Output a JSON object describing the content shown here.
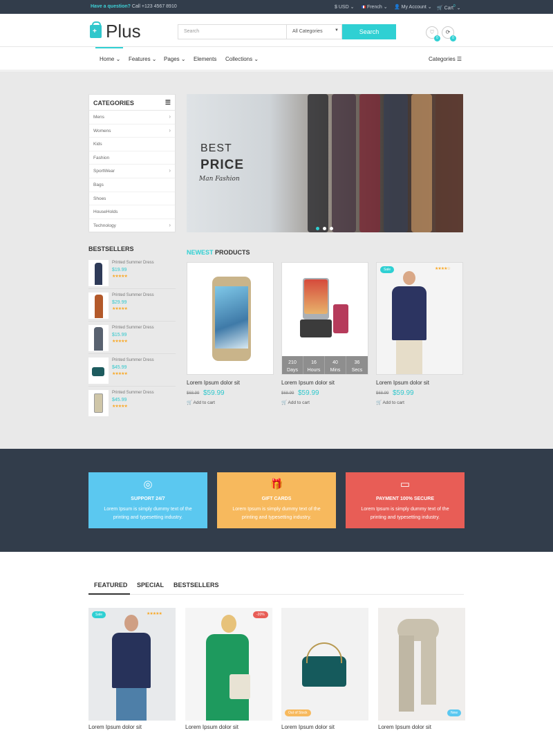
{
  "topbar": {
    "question": "Have a question?",
    "phone": "Call +123 4567 8910",
    "currency": "USD",
    "language": "French",
    "account": "My Account",
    "cart": "Cart",
    "cart_count": "0"
  },
  "header": {
    "logo": "Plus",
    "search_placeholder": "Search",
    "category_select": "All Categories",
    "search_button": "Search",
    "wishlist_count": "0",
    "compare_count": "0"
  },
  "nav": {
    "items": [
      "Home",
      "Features",
      "Pages",
      "Elements",
      "Collections"
    ],
    "right": "Categories"
  },
  "sidebar": {
    "title": "CATEGORIES",
    "items": [
      "Mens",
      "Womens",
      "Kids",
      "Fashion",
      "SportWear",
      "Bags",
      "Shoes",
      "HouseHolds",
      "Technology"
    ]
  },
  "banner": {
    "line1": "BEST",
    "line2": "PRICE",
    "line3": "Man Fashion"
  },
  "bestsellers": {
    "title": "BESTSELLERS",
    "items": [
      {
        "name": "Printed Summer Dress",
        "price": "$19.99",
        "stars": "★★★★★"
      },
      {
        "name": "Printed Summer Dress",
        "price": "$29.99",
        "stars": "★★★★★"
      },
      {
        "name": "Printed Summer Dress",
        "price": "$15.99",
        "stars": "★★★★★"
      },
      {
        "name": "Printed Summer Dress",
        "price": "$45.99",
        "stars": "★★★★★"
      },
      {
        "name": "Printed Summer Dress",
        "price": "$45.99",
        "stars": "★★★★★"
      }
    ]
  },
  "newest": {
    "title_accent": "NEWEST",
    "title_rest": "PRODUCTS",
    "products": [
      {
        "name": "Lorem Ipsum dolor sit",
        "old": "$68.99",
        "price": "$59.99",
        "add": "Add to cart"
      },
      {
        "name": "Lorem Ipsum dolor sit",
        "old": "$68.99",
        "price": "$59.99",
        "add": "Add to cart"
      },
      {
        "name": "Lorem Ipsum dolor sit",
        "old": "$68.99",
        "price": "$59.99",
        "add": "Add to cart",
        "badge": "Sale",
        "stars": "★★★★☆"
      }
    ],
    "timer": [
      {
        "value": "210",
        "unit": "Days"
      },
      {
        "value": "16",
        "unit": "Hours"
      },
      {
        "value": "40",
        "unit": "Mins"
      },
      {
        "value": "36",
        "unit": "Secs"
      }
    ]
  },
  "services": [
    {
      "title": "SUPPORT 24/7",
      "desc": "Lorem Ipsum is simply dummy text of the printing and typesetting industry.",
      "color": "#5bc8f0",
      "icon": "lifebuoy-icon"
    },
    {
      "title": "GIFT CARDS",
      "desc": "Lorem Ipsum is simply dummy text of the printing and typesetting industry.",
      "color": "#f7b95d",
      "icon": "gift-icon"
    },
    {
      "title": "PAYMENT 100% SECURE",
      "desc": "Lorem Ipsum is simply dummy text of the printing and typesetting industry.",
      "color": "#e85d56",
      "icon": "credit-card-icon"
    }
  ],
  "featured": {
    "tabs": [
      "FEATURED",
      "SPECIAL",
      "BESTSELLERS"
    ],
    "products": [
      {
        "name": "Lorem Ipsum dolor sit",
        "badge": "Sale",
        "stars": "★★★★★"
      },
      {
        "name": "Lorem Ipsum dolor sit",
        "badge": "-20%"
      },
      {
        "name": "Lorem Ipsum dolor sit",
        "badge": "Out of Stock"
      },
      {
        "name": "Lorem Ipsum dolor sit",
        "badge": "New"
      }
    ]
  }
}
